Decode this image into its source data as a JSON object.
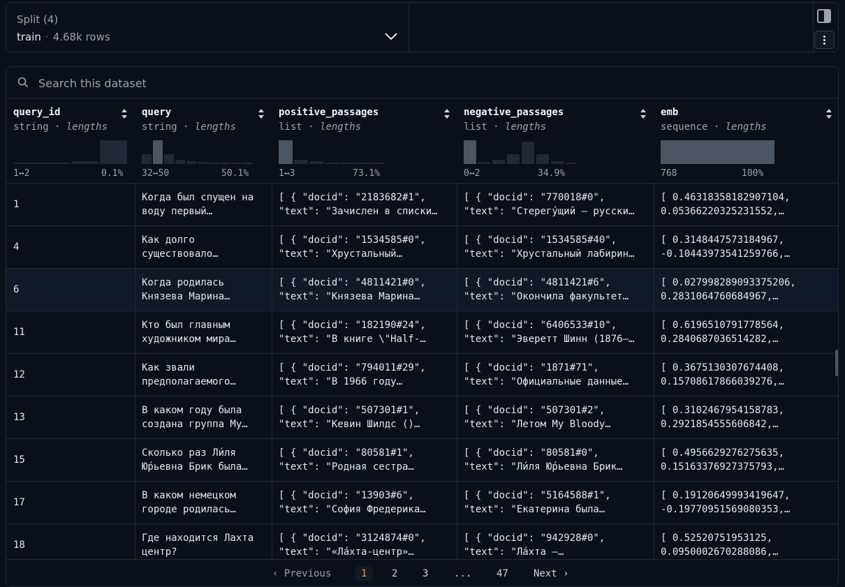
{
  "split": {
    "title": "Split (4)",
    "name": "train",
    "separator": "·",
    "rows": "4.68k rows"
  },
  "search": {
    "placeholder": "Search this dataset"
  },
  "columns": [
    {
      "name": "query_id",
      "type": "string",
      "stat": "lengths",
      "min": "1↔2",
      "pct": "0.1%"
    },
    {
      "name": "query",
      "type": "string",
      "stat": "lengths",
      "min": "32↔50",
      "pct": "50.1%"
    },
    {
      "name": "positive_passages",
      "type": "list",
      "stat": "lengths",
      "min": "1↔3",
      "pct": "73.1%"
    },
    {
      "name": "negative_passages",
      "type": "list",
      "stat": "lengths",
      "min": "0↔2",
      "pct": "34.9%"
    },
    {
      "name": "emb",
      "type": "sequence",
      "stat": "lengths",
      "min": "768",
      "pct": "100%"
    }
  ],
  "rows": [
    {
      "id": "1",
      "q1": "Когда был спущен на",
      "q2": "воду первый…",
      "p1": "[ { \"docid\": \"2183682#1\",",
      "p2": "\"text\": \"Зачислен в списки…",
      "n1": "[ { \"docid\": \"770018#0\",",
      "n2": "\"text\": \"Стерегу́щий — русски…",
      "e1": "[ 0.46318358182907104,",
      "e2": "0.05366220325231552,…"
    },
    {
      "id": "4",
      "q1": "Как долго",
      "q2": "существовало…",
      "p1": "[ { \"docid\": \"1534585#0\",",
      "p2": "\"text\": \"Хрустальный…",
      "n1": "[ { \"docid\": \"1534585#40\",",
      "n2": "\"text\": \"Хрустальный лабирин…",
      "e1": "[ 0.3148447573184967,",
      "e2": "-0.10443973541259766,…"
    },
    {
      "id": "6",
      "q1": "Когда родилась",
      "q2": "Князева Марина…",
      "p1": "[ { \"docid\": \"4811421#0\",",
      "p2": "\"text\": \"Князева Марина…",
      "n1": "[ { \"docid\": \"4811421#6\",",
      "n2": "\"text\": \"Окончила факультет…",
      "e1": "[ 0.027998289093375206,",
      "e2": "0.2831064760684967,…"
    },
    {
      "id": "11",
      "q1": "Кто был главным",
      "q2": "художником мира…",
      "p1": "[ { \"docid\": \"182190#24\",",
      "p2": "\"text\": \"В книге \\\"Half-…",
      "n1": "[ { \"docid\": \"6406533#10\",",
      "n2": "\"text\": \"Эверетт Шинн (1876–…",
      "e1": "[ 0.6196510791778564,",
      "e2": "0.2840687036514282,…"
    },
    {
      "id": "12",
      "q1": "Как звали",
      "q2": "предполагаемого…",
      "p1": "[ { \"docid\": \"794011#29\",",
      "p2": "\"text\": \"В 1966 году…",
      "n1": "[ { \"docid\": \"1871#71\",",
      "n2": "\"text\": \"Официальные данные…",
      "e1": "[ 0.3675130307674408,",
      "e2": "0.15708617866039276,…"
    },
    {
      "id": "13",
      "q1": "В каком году была",
      "q2": "создана группа My…",
      "p1": "[ { \"docid\": \"507301#1\",",
      "p2": "\"text\": \"Кевин Шилдс ()…",
      "n1": "[ { \"docid\": \"507301#2\",",
      "n2": "\"text\": \"Летом My Bloody…",
      "e1": "[ 0.3102467954158783,",
      "e2": "0.2921854555606842,…"
    },
    {
      "id": "15",
      "q1": "Сколько раз Ли́ля",
      "q2": "Ю́рьевна Брик была…",
      "p1": "[ { \"docid\": \"80581#1\",",
      "p2": "\"text\": \"Родная сестра…",
      "n1": "[ { \"docid\": \"80581#0\",",
      "n2": "\"text\": \"Ли́ля Ю́рьевна Брик…",
      "e1": "[ 0.4956629276275635,",
      "e2": "0.15163376927375793,…"
    },
    {
      "id": "17",
      "q1": "В каком немецком",
      "q2": "городе родилась…",
      "p1": "[ { \"docid\": \"13903#6\",",
      "p2": "\"text\": \"София Фредерика…",
      "n1": "[ { \"docid\": \"5164588#1\",",
      "n2": "\"text\": \"Екатерина была…",
      "e1": "[ 0.19120649993419647,",
      "e2": "-0.19770951569080353,…"
    },
    {
      "id": "18",
      "q1": "Где находится Лахта",
      "q2": "центр?",
      "p1": "[ { \"docid\": \"3124874#0\",",
      "p2": "\"text\": \"«Ла́хта-центр»…",
      "n1": "[ { \"docid\": \"942928#0\",",
      "n2": "\"text\": \"Ла́хта —…",
      "e1": "[ 0.52520751953125,",
      "e2": "0.0950002670288086,…"
    }
  ],
  "pagination": {
    "previous": "Previous",
    "pages": [
      "1",
      "2",
      "3",
      "...",
      "47"
    ],
    "current": "1",
    "next": "Next"
  },
  "colors": {
    "accent": "#f59e0b",
    "background": "#0b0f19",
    "border": "#1f2937"
  }
}
